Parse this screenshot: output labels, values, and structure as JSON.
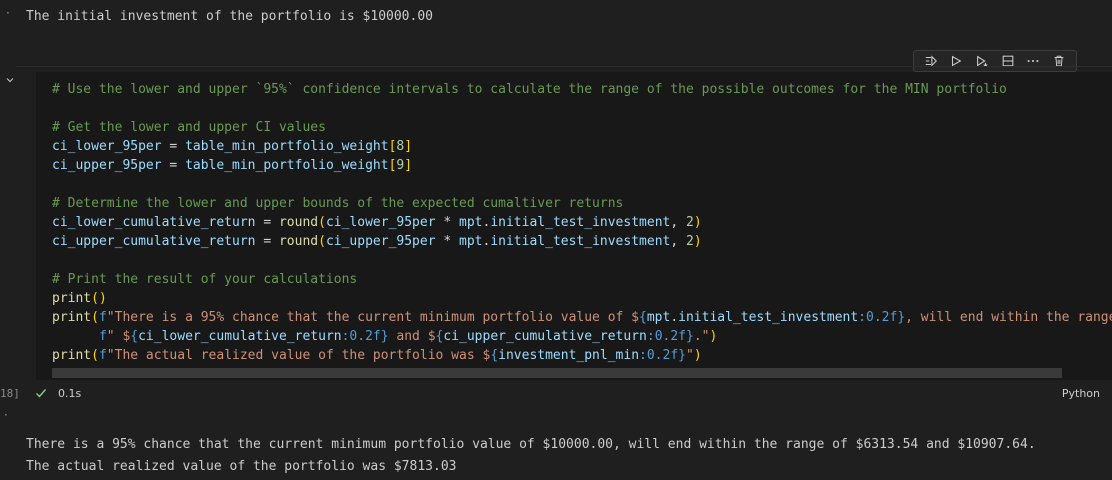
{
  "top_output": {
    "text": "The initial investment of the portfolio is $10000.00"
  },
  "toolbar": {
    "buttons": [
      {
        "icon": "execute-above-icon"
      },
      {
        "icon": "execute-cell-icon"
      },
      {
        "icon": "execute-below-icon"
      },
      {
        "icon": "split-cell-icon"
      },
      {
        "icon": "more-icon"
      },
      {
        "icon": "trash-icon"
      }
    ]
  },
  "cell": {
    "lines": [
      [
        {
          "t": "# Use the lower and upper `95%` confidence intervals to calculate the range of the possible outcomes for the MIN portfolio",
          "c": "cm"
        }
      ],
      [],
      [
        {
          "t": "# Get the lower and upper CI values",
          "c": "cm"
        }
      ],
      [
        {
          "t": "ci_lower_95per",
          "c": "id"
        },
        {
          "t": " = ",
          "c": "op"
        },
        {
          "t": "table_min_portfolio_weight",
          "c": "id"
        },
        {
          "t": "[",
          "c": "br"
        },
        {
          "t": "8",
          "c": "nm"
        },
        {
          "t": "]",
          "c": "br"
        }
      ],
      [
        {
          "t": "ci_upper_95per",
          "c": "id"
        },
        {
          "t": " = ",
          "c": "op"
        },
        {
          "t": "table_min_portfolio_weight",
          "c": "id"
        },
        {
          "t": "[",
          "c": "br"
        },
        {
          "t": "9",
          "c": "nm"
        },
        {
          "t": "]",
          "c": "br"
        }
      ],
      [],
      [
        {
          "t": "# Determine the lower and upper bounds of the expected cumaltiver returns",
          "c": "cm"
        }
      ],
      [
        {
          "t": "ci_lower_cumulative_return",
          "c": "id"
        },
        {
          "t": " = ",
          "c": "op"
        },
        {
          "t": "round",
          "c": "fn"
        },
        {
          "t": "(",
          "c": "br"
        },
        {
          "t": "ci_lower_95per",
          "c": "id"
        },
        {
          "t": " * ",
          "c": "op"
        },
        {
          "t": "mpt",
          "c": "id"
        },
        {
          "t": ".",
          "c": "op"
        },
        {
          "t": "initial_test_investment",
          "c": "id"
        },
        {
          "t": ", ",
          "c": "op"
        },
        {
          "t": "2",
          "c": "nm"
        },
        {
          "t": ")",
          "c": "br"
        }
      ],
      [
        {
          "t": "ci_upper_cumulative_return",
          "c": "id"
        },
        {
          "t": " = ",
          "c": "op"
        },
        {
          "t": "round",
          "c": "fn"
        },
        {
          "t": "(",
          "c": "br"
        },
        {
          "t": "ci_upper_95per",
          "c": "id"
        },
        {
          "t": " * ",
          "c": "op"
        },
        {
          "t": "mpt",
          "c": "id"
        },
        {
          "t": ".",
          "c": "op"
        },
        {
          "t": "initial_test_investment",
          "c": "id"
        },
        {
          "t": ", ",
          "c": "op"
        },
        {
          "t": "2",
          "c": "nm"
        },
        {
          "t": ")",
          "c": "br"
        }
      ],
      [],
      [
        {
          "t": "# Print the result of your calculations",
          "c": "cm"
        }
      ],
      [
        {
          "t": "print",
          "c": "fn"
        },
        {
          "t": "()",
          "c": "br"
        }
      ],
      [
        {
          "t": "print",
          "c": "fn"
        },
        {
          "t": "(",
          "c": "br"
        },
        {
          "t": "f",
          "c": "bl"
        },
        {
          "t": "\"There is a 95% chance that the current minimum portfolio value of $",
          "c": "st"
        },
        {
          "t": "{",
          "c": "bl"
        },
        {
          "t": "mpt",
          "c": "id"
        },
        {
          "t": ".",
          "c": "op"
        },
        {
          "t": "initial_test_investment",
          "c": "id"
        },
        {
          "t": ":0.2f",
          "c": "bl"
        },
        {
          "t": "}",
          "c": "bl"
        },
        {
          "t": ", will end within the range of",
          "c": "st"
        }
      ],
      [
        {
          "t": "      f",
          "c": "bl"
        },
        {
          "t": "\" $",
          "c": "st"
        },
        {
          "t": "{",
          "c": "bl"
        },
        {
          "t": "ci_lower_cumulative_return",
          "c": "id"
        },
        {
          "t": ":0.2f",
          "c": "bl"
        },
        {
          "t": "}",
          "c": "bl"
        },
        {
          "t": " and $",
          "c": "st"
        },
        {
          "t": "{",
          "c": "bl"
        },
        {
          "t": "ci_upper_cumulative_return",
          "c": "id"
        },
        {
          "t": ":0.2f",
          "c": "bl"
        },
        {
          "t": "}",
          "c": "bl"
        },
        {
          "t": ".\"",
          "c": "st"
        },
        {
          "t": ")",
          "c": "br"
        }
      ],
      [
        {
          "t": "print",
          "c": "fn"
        },
        {
          "t": "(",
          "c": "br"
        },
        {
          "t": "f",
          "c": "bl"
        },
        {
          "t": "\"The actual realized value of the portfolio was $",
          "c": "st"
        },
        {
          "t": "{",
          "c": "bl"
        },
        {
          "t": "investment_pnl_min",
          "c": "id"
        },
        {
          "t": ":0.2f",
          "c": "bl"
        },
        {
          "t": "}",
          "c": "bl"
        },
        {
          "t": "\"",
          "c": "st"
        },
        {
          "t": ")",
          "c": "br"
        }
      ]
    ],
    "execution_count": "18]",
    "duration": "0.1s",
    "language": "Python"
  },
  "output": {
    "lines": [
      "There is a 95% chance that the current minimum portfolio value of $10000.00, will end within the range of $6313.54 and $10907.64.",
      "The actual realized value of the portfolio was $7813.03"
    ]
  },
  "colors": {
    "background": "#1f1f1f",
    "editor": "#181818",
    "comment": "#6a9955",
    "function": "#dcdcaa",
    "string": "#ce9178",
    "number": "#b5cea8",
    "identifier": "#9cdcfe",
    "success": "#89d185"
  }
}
